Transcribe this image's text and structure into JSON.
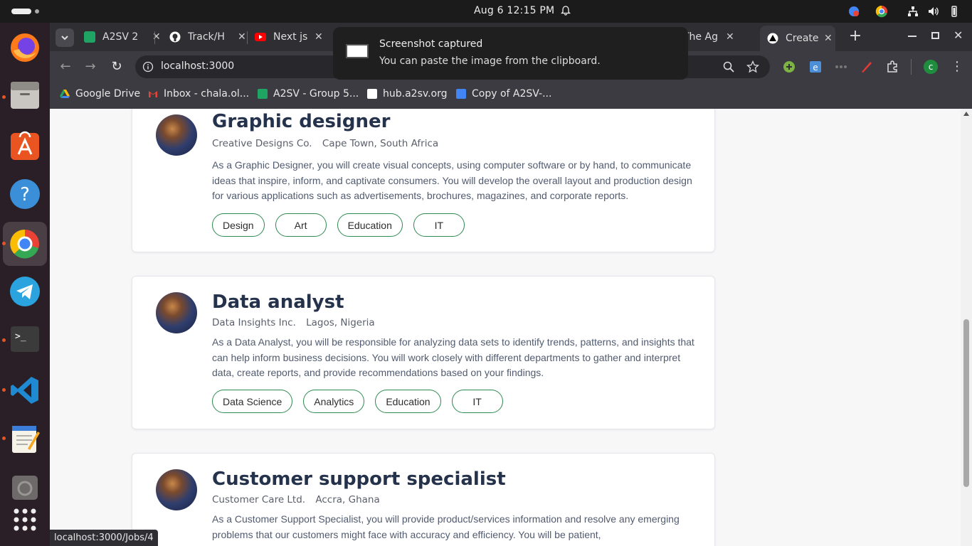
{
  "system": {
    "clock": "Aug 6  12:15 PM"
  },
  "browser": {
    "tabs": [
      {
        "label": "A2SV 2",
        "icon_color": "#1fa463"
      },
      {
        "label": "Track/H",
        "icon_color": "#ffffff"
      },
      {
        "label": "Next js",
        "icon_color": "#ff0000"
      },
      {
        "label": "The Ag",
        "icon_color": "#ffffff"
      },
      {
        "label": "Create",
        "icon_color": "#ffffff"
      }
    ],
    "url": "localhost:3000",
    "bookmarks": [
      {
        "label": "Google Drive",
        "icon_color": "#fbbc04"
      },
      {
        "label": "Inbox - chala.ol...",
        "icon_color": "#ea4335"
      },
      {
        "label": "A2SV - Group 5...",
        "icon_color": "#1fa463"
      },
      {
        "label": "hub.a2sv.org",
        "icon_color": "#ffffff"
      },
      {
        "label": "Copy of A2SV-...",
        "icon_color": "#4285f4"
      }
    ],
    "status_url": "localhost:3000/Jobs/4"
  },
  "notification": {
    "title": "Screenshot captured",
    "body": "You can paste the image from the clipboard."
  },
  "jobs": [
    {
      "title": "Graphic designer",
      "company": "Creative Designs Co.",
      "location": "Cape Town, South Africa",
      "description": "As a Graphic Designer, you will create visual concepts, using computer software or by hand, to communicate ideas that inspire, inform, and captivate consumers. You will develop the overall layout and production design for various applications such as advertisements, brochures, magazines, and corporate reports.",
      "tags": [
        "Design",
        "Art",
        "Education",
        "IT"
      ]
    },
    {
      "title": "Data analyst",
      "company": "Data Insights Inc.",
      "location": "Lagos, Nigeria",
      "description": "As a Data Analyst, you will be responsible for analyzing data sets to identify trends, patterns, and insights that can help inform business decisions. You will work closely with different departments to gather and interpret data, create reports, and provide recommendations based on your findings.",
      "tags": [
        "Data Science",
        "Analytics",
        "Education",
        "IT"
      ]
    },
    {
      "title": "Customer support specialist",
      "company": "Customer Care Ltd.",
      "location": "Accra, Ghana",
      "description": "As a Customer Support Specialist, you will provide product/services information and resolve any emerging problems that our customers might face with accuracy and efficiency. You will be patient,",
      "tags": []
    }
  ],
  "colors": {
    "tag_border": "#2e8a4f",
    "title": "#25324b",
    "accent_dock": "#e95420"
  }
}
